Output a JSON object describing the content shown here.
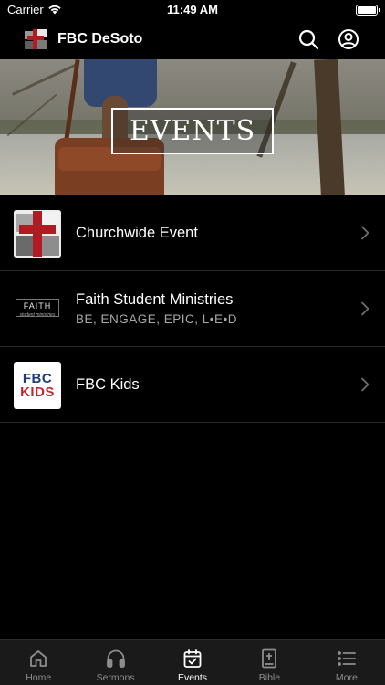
{
  "status_bar": {
    "carrier": "Carrier",
    "time": "11:49 AM"
  },
  "nav": {
    "title": "FBC DeSoto",
    "icons": [
      "search-icon",
      "account-icon"
    ]
  },
  "hero": {
    "title": "EVENTS"
  },
  "events": [
    {
      "title": "Churchwide Event",
      "subtitle": "",
      "thumbnail": "churchwide-logo"
    },
    {
      "title": "Faith Student Ministries",
      "subtitle": "BE, ENGAGE, EPIC, L•E•D",
      "thumbnail": "faith-logo",
      "thumb_text": "FAITH",
      "thumb_subtext": "student ministries"
    },
    {
      "title": "FBC Kids",
      "subtitle": "",
      "thumbnail": "fbc-kids-logo",
      "thumb_line1": "FBC",
      "thumb_line2": "KIDS"
    }
  ],
  "tabs": [
    {
      "label": "Home",
      "icon": "home-icon",
      "active": false
    },
    {
      "label": "Sermons",
      "icon": "headphones-icon",
      "active": false
    },
    {
      "label": "Events",
      "icon": "calendar-icon",
      "active": true
    },
    {
      "label": "Bible",
      "icon": "bible-icon",
      "active": false
    },
    {
      "label": "More",
      "icon": "list-icon",
      "active": false
    }
  ],
  "colors": {
    "background": "#000000",
    "accent_red": "#b01c22",
    "tab_inactive": "#8d8d8d",
    "tab_active": "#ffffff"
  }
}
